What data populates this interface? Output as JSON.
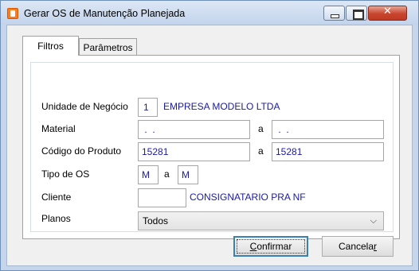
{
  "window": {
    "title": "Gerar OS de Manutenção Planejada",
    "icon": "app-icon",
    "controls": [
      "minimize-icon",
      "maximize-icon",
      "close-icon"
    ]
  },
  "tabs": [
    {
      "label": "Filtros",
      "active": true
    },
    {
      "label": "Parâmetros",
      "active": false
    }
  ],
  "form": {
    "unidade": {
      "label": "Unidade de Negócio",
      "code": "1",
      "name": "EMPRESA MODELO LTDA"
    },
    "material": {
      "label": "Material",
      "from": " .  .",
      "sep": "a",
      "to": " .  ."
    },
    "codigo": {
      "label": "Código do Produto",
      "from": "15281",
      "sep": "a",
      "to": "15281"
    },
    "tipo_os": {
      "label": "Tipo de OS",
      "from": "M",
      "sep": "a",
      "to": "M"
    },
    "cliente": {
      "label": "Cliente",
      "code": "",
      "name": "CONSIGNATARIO PRA NF"
    },
    "planos": {
      "label": "Planos",
      "selected": "Todos"
    }
  },
  "buttons": {
    "confirm_prefix": "C",
    "confirm_rest": "onfirmar",
    "cancel_prefix": "Cancela",
    "cancel_rest": "r"
  },
  "colors": {
    "value_text": "#1a1aa6",
    "focus_border": "#3c7fb1",
    "title_bar": "#c2d4ec"
  }
}
